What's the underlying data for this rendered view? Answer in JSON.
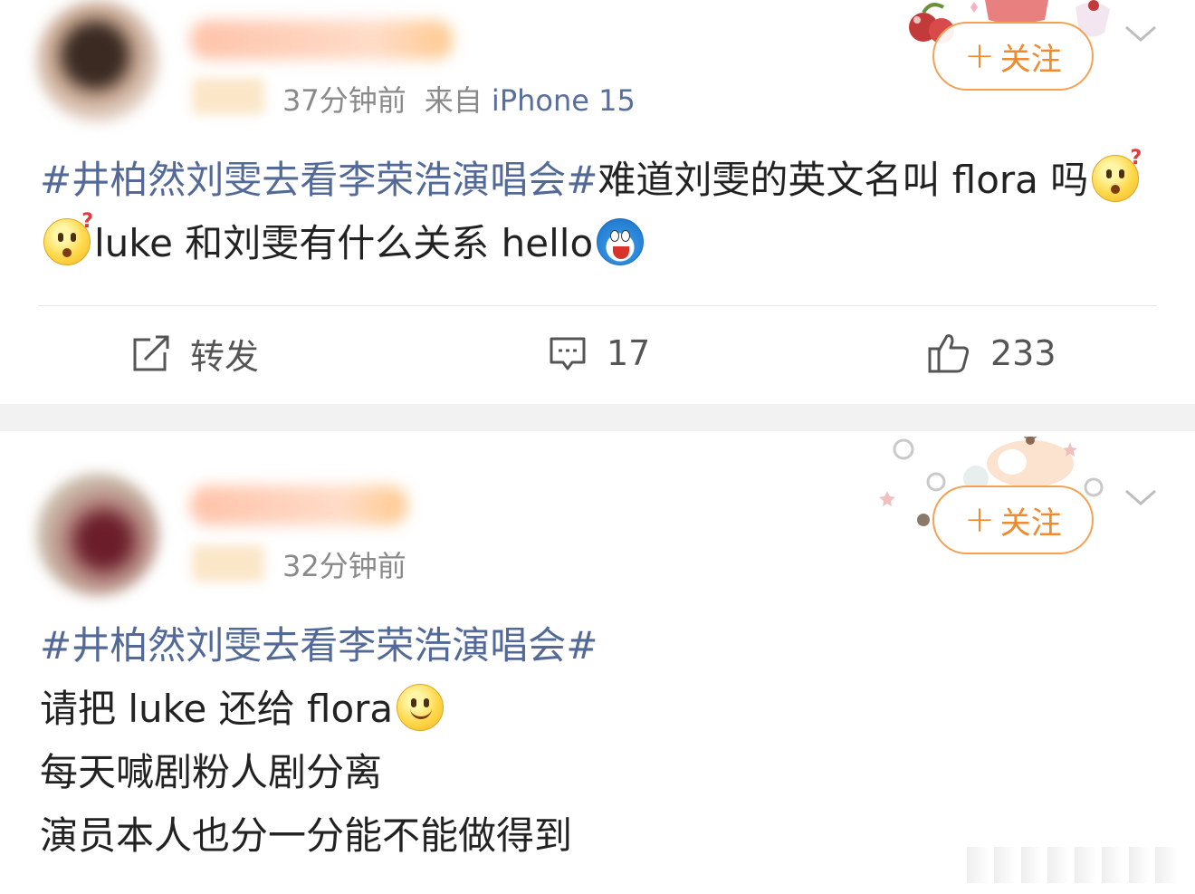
{
  "posts": [
    {
      "time": "37分钟前",
      "source_prefix": "来自",
      "source": "iPhone 15",
      "follow_plus": "+",
      "follow_label": "关注",
      "topic": "#井柏然刘雯去看李荣浩演唱会#",
      "text_a": "难道刘雯的英文名叫 flora 吗",
      "text_b": "luke 和刘雯有什么关系 hello",
      "actions": {
        "share": "转发",
        "comments": "17",
        "likes": "233"
      }
    },
    {
      "time": "32分钟前",
      "follow_plus": "+",
      "follow_label": "关注",
      "topic": "#井柏然刘雯去看李荣浩演唱会#",
      "line1": "请把 luke 还给 flora",
      "line2": "每天喊剧粉人剧分离",
      "line3": "演员本人也分一分能不能做得到"
    }
  ],
  "icons": {
    "share": "share-edit-icon",
    "comment": "comment-bubble-icon",
    "like": "thumbs-up-icon",
    "more": "chevron-down-icon"
  },
  "colors": {
    "topic": "#536a99",
    "follow": "#f08a2c",
    "meta": "#8a8a8a",
    "source": "#5a6e9c"
  }
}
